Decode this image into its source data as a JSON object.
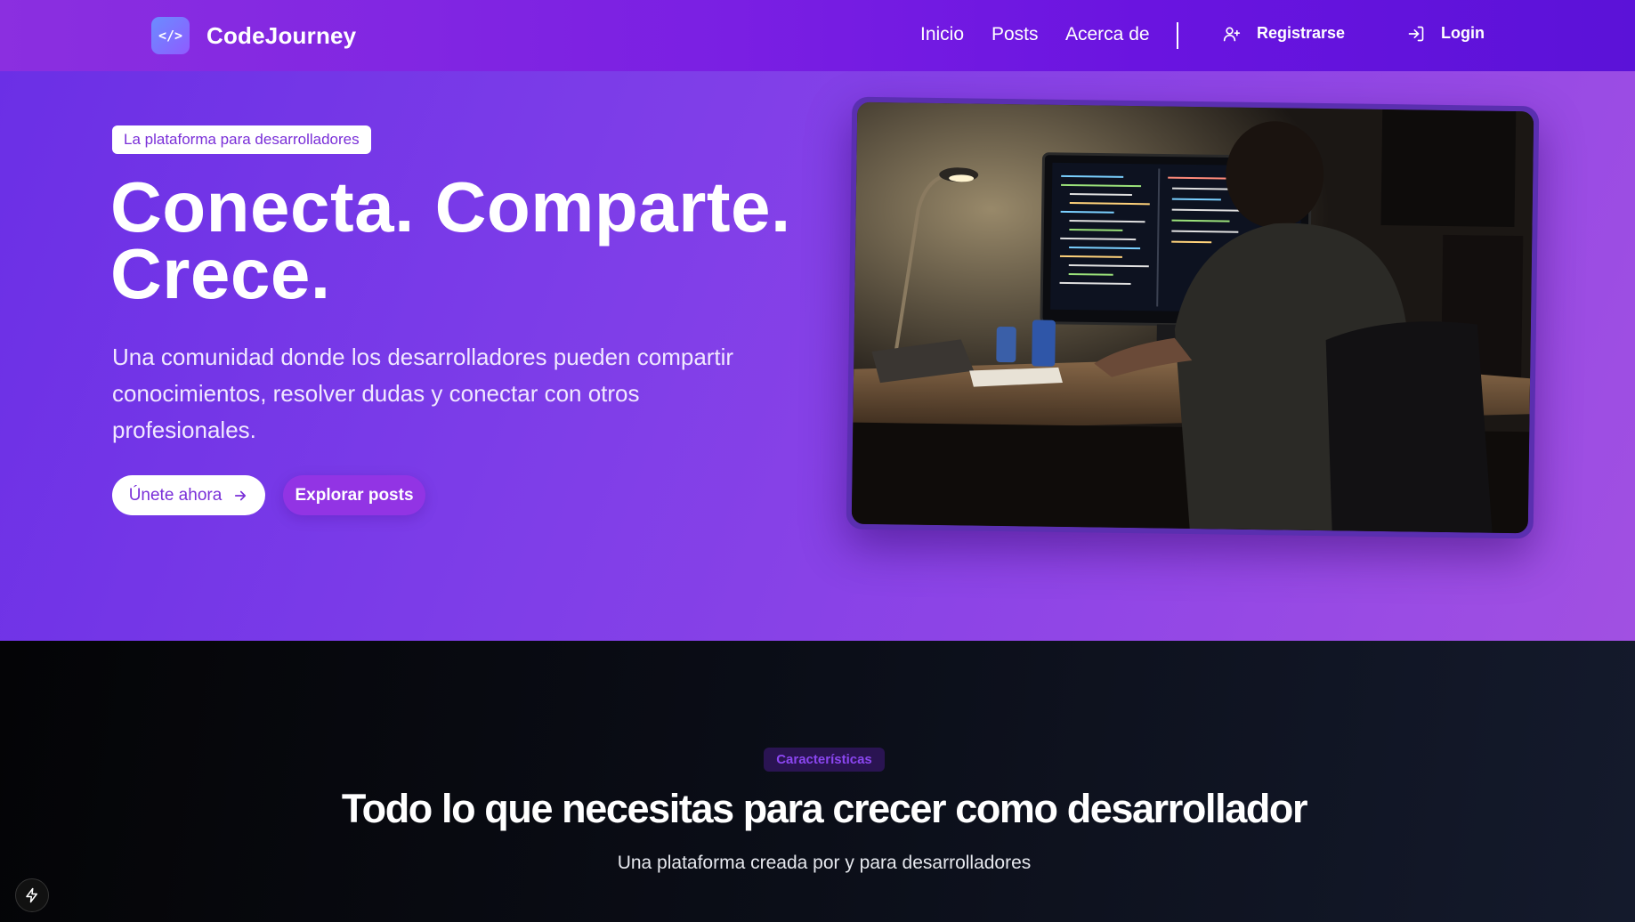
{
  "brand": {
    "name": "CodeJourney",
    "logo_glyph": "</>"
  },
  "nav": {
    "links": [
      "Inicio",
      "Posts",
      "Acerca de"
    ],
    "register_label": "Registrarse",
    "login_label": "Login"
  },
  "hero": {
    "badge": "La plataforma para desarrolladores",
    "title_line1": "Conecta. Comparte.",
    "title_line2": "Crece.",
    "subtitle": "Una comunidad donde los desarrolladores pueden compartir conocimientos, resolver dudas y conectar con otros profesionales.",
    "primary_button": "Únete ahora",
    "secondary_button": "Explorar posts"
  },
  "features": {
    "badge": "Características",
    "title": "Todo lo que necesitas para crecer como desarrollador",
    "subtitle": "Una plataforma creada por y para desarrolladores"
  },
  "colors": {
    "nav_gradient_start": "#8b2fe0",
    "nav_gradient_end": "#5b12d8",
    "hero_start": "#6b2fe6",
    "hero_end": "#a150e2",
    "accent_text": "#7a2fd8",
    "dark_section": "#0b0e18"
  }
}
